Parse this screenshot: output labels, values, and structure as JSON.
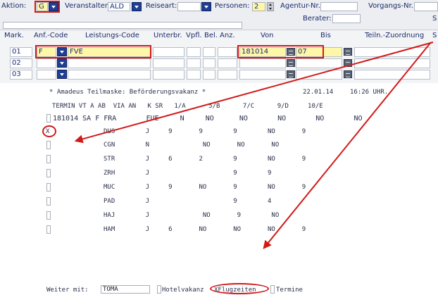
{
  "toolbar": {
    "aktion_label": "Aktion:",
    "aktion_value": "G",
    "veranstalter_label": "Veranstalter:",
    "veranstalter_value": "ALD",
    "reiseart_label": "Reiseart:",
    "reiseart_value": "",
    "personen_label": "Personen:",
    "personen_value": "2",
    "agentur_label": "Agentur-Nr.:",
    "agentur_value": "",
    "vorgangs_label": "Vorgangs-Nr.:",
    "vorgangs_value": "",
    "berater_label": "Berater:",
    "berater_value": "",
    "edge_char": "S"
  },
  "grid": {
    "headers": [
      "Mark.",
      "Anf.-Code",
      "Leistungs-Code",
      "Unterbr.",
      "Vpfl.",
      "Bel.",
      "Anz.",
      "Von",
      "Bis",
      "Teiln.-Zuordnung",
      "S"
    ],
    "rows": [
      {
        "mark": "01",
        "anf": "F",
        "leistung": "FVE",
        "von": "181014",
        "bis": "07"
      },
      {
        "mark": "02",
        "anf": "",
        "leistung": "",
        "von": "",
        "bis": ""
      },
      {
        "mark": "03",
        "anf": "",
        "leistung": "",
        "von": "",
        "bis": ""
      }
    ]
  },
  "mask": {
    "title": "* Amadeus Teilmaske: Beförderungsvakanz *",
    "date": "22.01.14",
    "time": "16:26 UHR.",
    "col_header": "TERMIN VT A AB  VIA AN   K SR   1/A      5/B      7/C      9/D     10/E",
    "first_line": "181014 SA F FRA       FUE     N     NO      NO       NO       NO       NO",
    "rows": [
      {
        "mark": "X",
        "line": "DUS        J     9       9        9        NO       9"
      },
      {
        "mark": "",
        "line": "CGN        N              NO       NO       NO"
      },
      {
        "mark": "",
        "line": "STR        J     6       2        9        NO       9"
      },
      {
        "mark": "",
        "line": "ZRH        J                      9        9"
      },
      {
        "mark": "",
        "line": "MUC        J     9       NO       9        NO       9"
      },
      {
        "mark": "",
        "line": "PAD        J                      9        4"
      },
      {
        "mark": "",
        "line": "HAJ        J              NO       9        NO"
      },
      {
        "mark": "",
        "line": "HAM        J     6       NO       NO       NO       9"
      }
    ],
    "weiter_label": "Weiter mit:",
    "weiter_value": "TOMA",
    "hotel_label": "Hotelvakanz",
    "flug_label": "XFlugzeiten",
    "termine_label": "Termine"
  },
  "colors": {
    "highlight_yellow": "#fff7a8",
    "annotation_red": "#d11a1a",
    "dropdown_blue": "#1f3f94"
  }
}
